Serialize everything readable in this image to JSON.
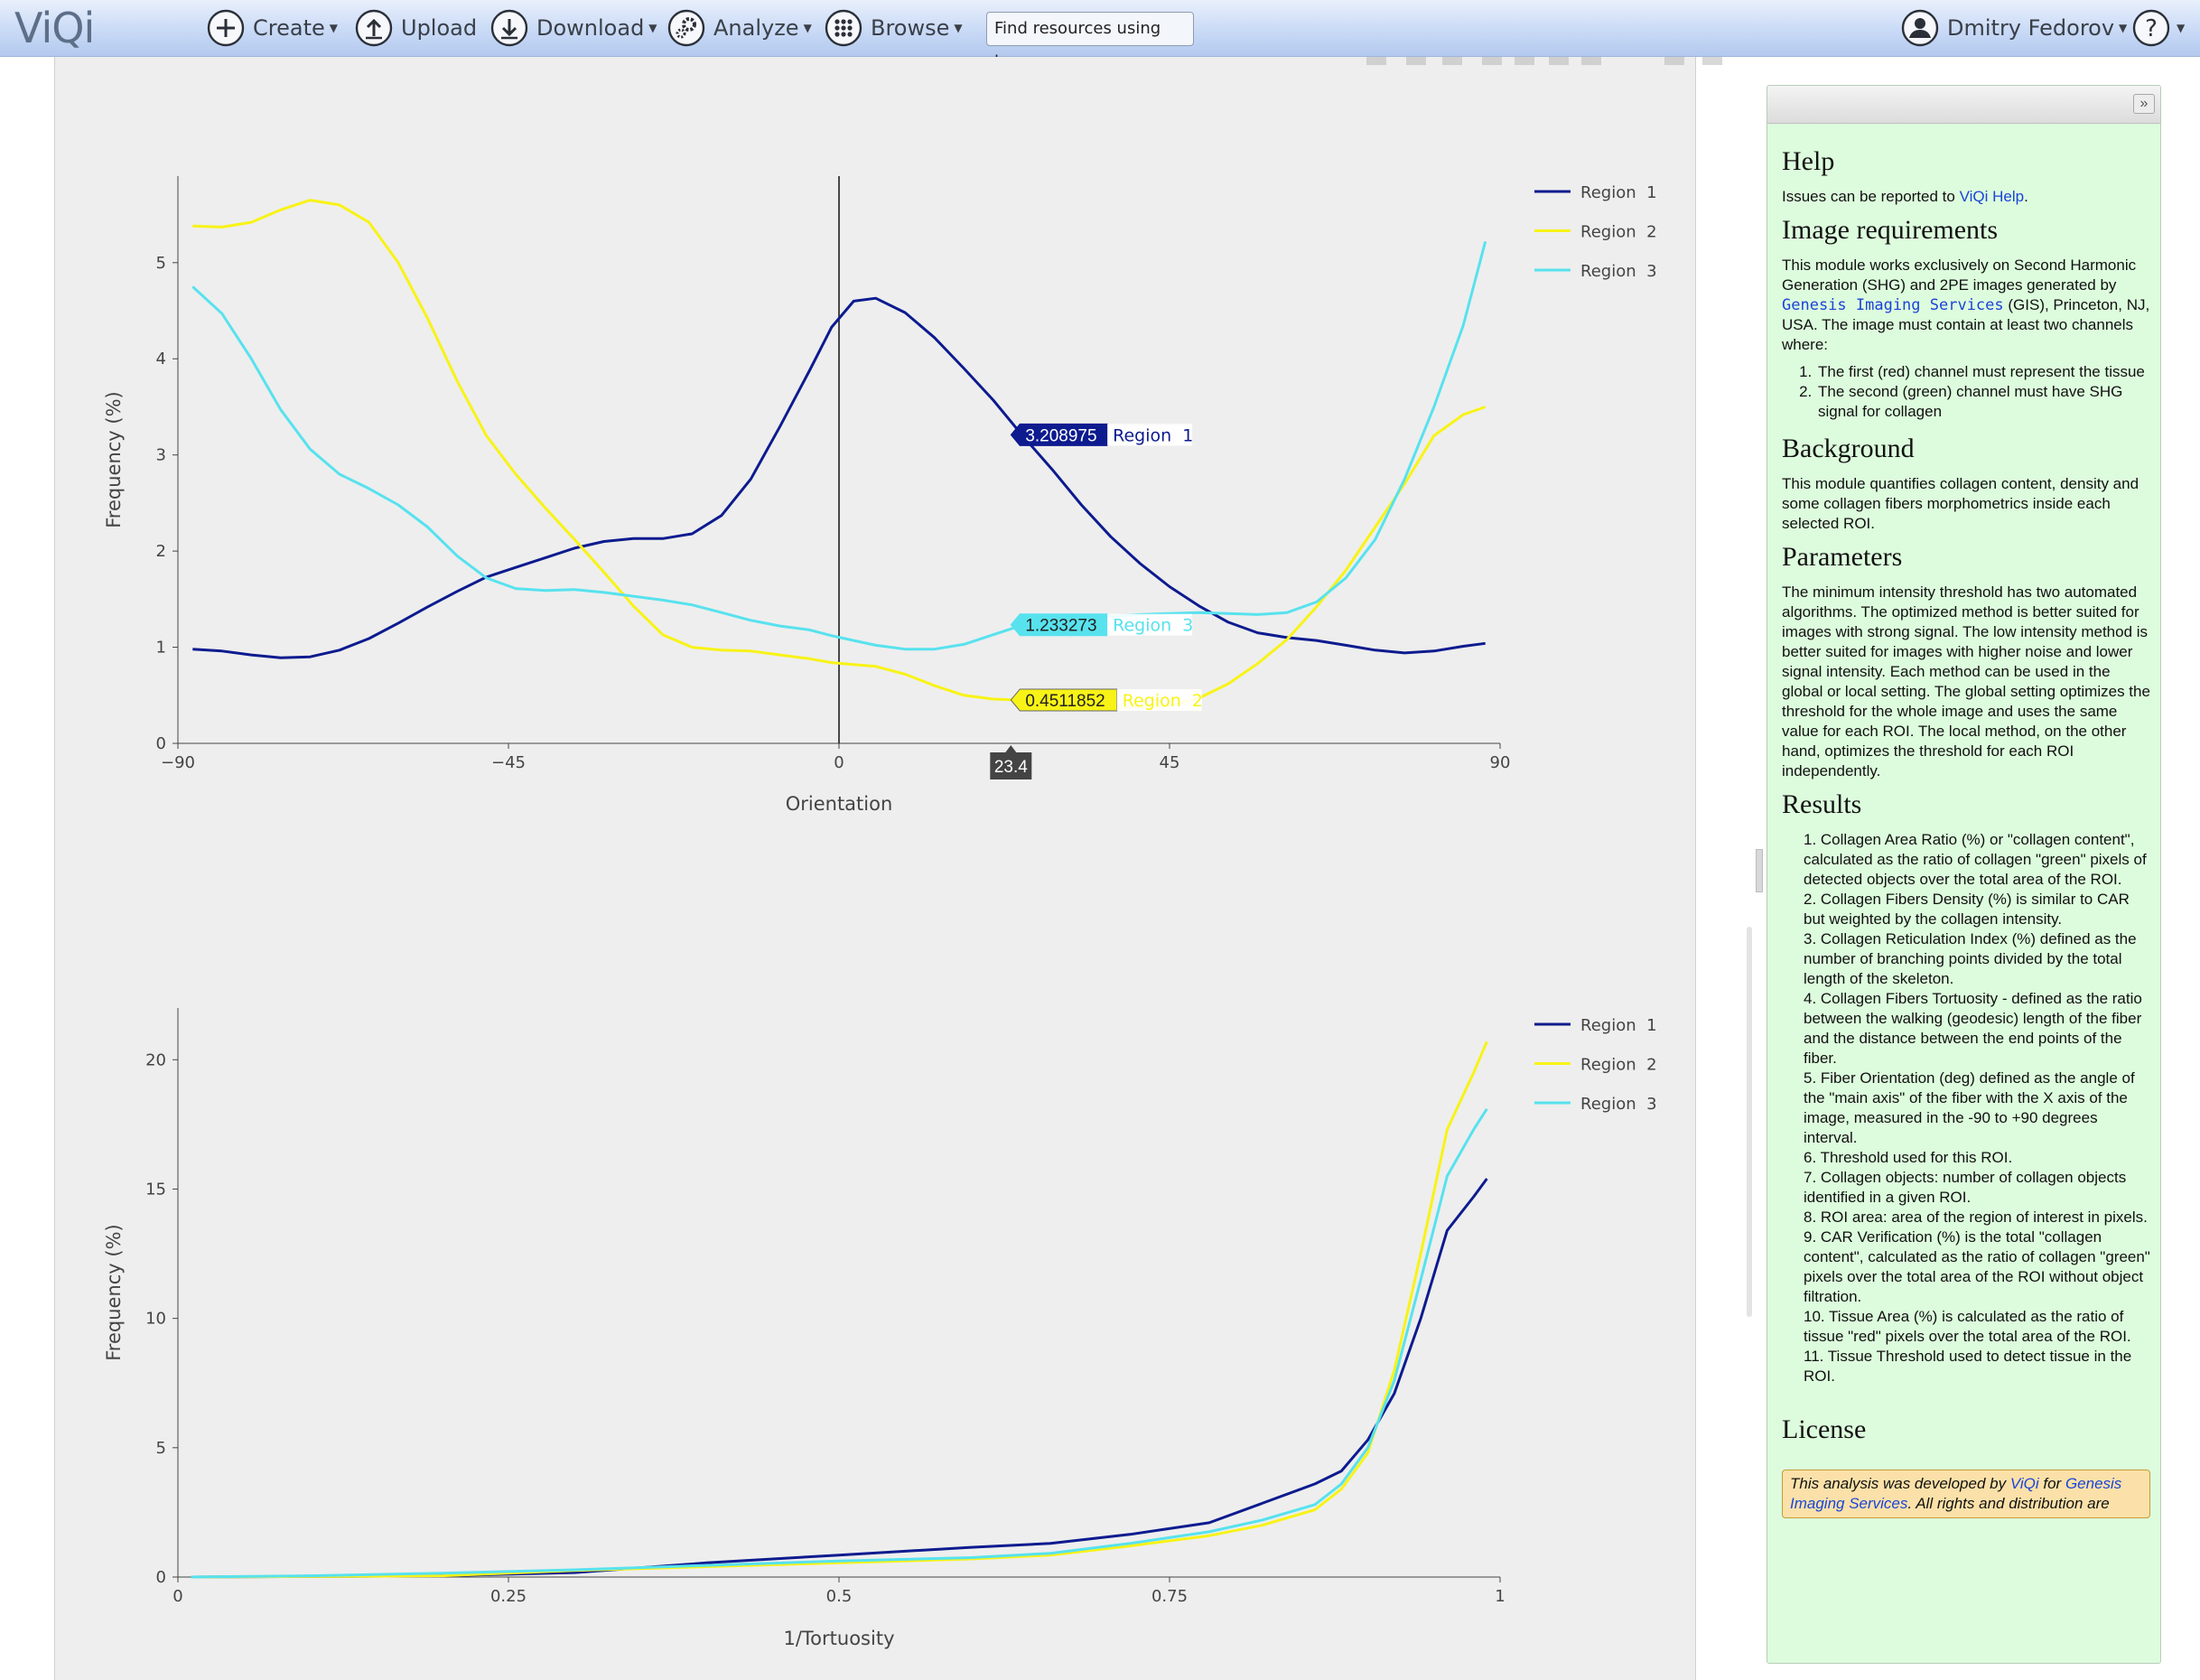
{
  "app": {
    "logo": "ViQi"
  },
  "nav": {
    "create": "Create",
    "upload": "Upload",
    "download": "Download",
    "analyze": "Analyze",
    "browse": "Browse",
    "tag_search": "Find resources using tags",
    "user": "Dmitry Fedorov",
    "help_menu": "?"
  },
  "colors": {
    "region1": "#0d1b8f",
    "region2": "#f8f316",
    "region3": "#57e2ee",
    "panel_bg": "#ddfcdd",
    "plot_bg": "#eeeeee"
  },
  "chart_data": [
    {
      "type": "line",
      "xlabel": "Orientation",
      "ylabel": "Frequency (%)",
      "xlim": [
        -90,
        90
      ],
      "ylim": [
        0,
        5.9
      ],
      "x_ticks": [
        -90,
        -45,
        0,
        45,
        90
      ],
      "x_tick_labels": [
        "−90",
        "−45",
        "0",
        "45",
        "90"
      ],
      "y_ticks": [
        0,
        1,
        2,
        3,
        4,
        5
      ],
      "y_tick_labels": [
        "0",
        "1",
        "2",
        "3",
        "4",
        "5"
      ],
      "grid": false,
      "legend_position": "top-right",
      "x": [
        -88,
        -84,
        -80,
        -76,
        -72,
        -68,
        -64,
        -60,
        -56,
        -52,
        -48,
        -44,
        -40,
        -36,
        -32,
        -28,
        -24,
        -20,
        -16,
        -12,
        -8,
        -4,
        -1,
        2,
        5,
        9,
        13,
        17,
        21,
        25,
        29,
        33,
        37,
        41,
        45,
        49,
        53,
        57,
        61,
        65,
        69,
        73,
        77,
        81,
        85,
        88
      ],
      "series": [
        {
          "name": "Region 1",
          "values": [
            0.98,
            0.96,
            0.92,
            0.89,
            0.9,
            0.97,
            1.09,
            1.25,
            1.42,
            1.58,
            1.73,
            1.83,
            1.93,
            2.03,
            2.1,
            2.13,
            2.13,
            2.18,
            2.37,
            2.75,
            3.3,
            3.88,
            4.33,
            4.6,
            4.63,
            4.48,
            4.22,
            3.9,
            3.57,
            3.2,
            2.85,
            2.48,
            2.15,
            1.87,
            1.63,
            1.43,
            1.26,
            1.15,
            1.1,
            1.07,
            1.02,
            0.97,
            0.94,
            0.96,
            1.01,
            1.04
          ]
        },
        {
          "name": "Region 2",
          "values": [
            5.38,
            5.37,
            5.42,
            5.55,
            5.65,
            5.6,
            5.42,
            5.0,
            4.42,
            3.77,
            3.2,
            2.8,
            2.45,
            2.12,
            1.78,
            1.43,
            1.13,
            1.0,
            0.97,
            0.96,
            0.92,
            0.88,
            0.84,
            0.82,
            0.8,
            0.72,
            0.6,
            0.5,
            0.46,
            0.45,
            0.46,
            0.4,
            0.37,
            0.38,
            0.39,
            0.47,
            0.62,
            0.83,
            1.08,
            1.42,
            1.8,
            2.25,
            2.7,
            3.2,
            3.42,
            3.5
          ]
        },
        {
          "name": "Region 3",
          "values": [
            4.75,
            4.47,
            4.0,
            3.47,
            3.06,
            2.8,
            2.65,
            2.48,
            2.25,
            1.95,
            1.72,
            1.61,
            1.59,
            1.6,
            1.57,
            1.53,
            1.49,
            1.44,
            1.36,
            1.28,
            1.22,
            1.18,
            1.12,
            1.07,
            1.02,
            0.98,
            0.98,
            1.03,
            1.13,
            1.23,
            1.26,
            1.29,
            1.32,
            1.34,
            1.35,
            1.36,
            1.35,
            1.34,
            1.36,
            1.47,
            1.72,
            2.12,
            2.75,
            3.5,
            4.35,
            5.22
          ]
        }
      ],
      "hover": {
        "x_label": "23.4",
        "labels": [
          {
            "value": "3.208975",
            "name": "Region 1",
            "y": 3.208975
          },
          {
            "value": "1.233273",
            "name": "Region 3",
            "y": 1.233273
          },
          {
            "value": "0.4511852",
            "name": "Region 2",
            "y": 0.4511852
          }
        ]
      }
    },
    {
      "type": "line",
      "xlabel": "1/Tortuosity",
      "ylabel": "Frequency (%)",
      "xlim": [
        0,
        1
      ],
      "ylim": [
        0,
        22
      ],
      "x_ticks": [
        0,
        0.25,
        0.5,
        0.75,
        1
      ],
      "x_tick_labels": [
        "0",
        "0.25",
        "0.5",
        "0.75",
        "1"
      ],
      "y_ticks": [
        0,
        5,
        10,
        15,
        20
      ],
      "y_tick_labels": [
        "0",
        "5",
        "10",
        "15",
        "20"
      ],
      "grid": false,
      "legend_position": "top-right",
      "x": [
        0.01,
        0.1,
        0.2,
        0.3,
        0.4,
        0.5,
        0.6,
        0.66,
        0.72,
        0.78,
        0.82,
        0.86,
        0.88,
        0.9,
        0.92,
        0.94,
        0.96,
        0.98,
        0.99
      ],
      "series": [
        {
          "name": "Region 1",
          "values": [
            0.0,
            0.02,
            0.05,
            0.17,
            0.55,
            0.85,
            1.15,
            1.3,
            1.65,
            2.1,
            2.85,
            3.6,
            4.1,
            5.3,
            7.1,
            10.0,
            13.4,
            14.7,
            15.4
          ]
        },
        {
          "name": "Region 2",
          "values": [
            0.0,
            0.02,
            0.05,
            0.25,
            0.4,
            0.55,
            0.7,
            0.85,
            1.2,
            1.6,
            2.0,
            2.6,
            3.4,
            4.8,
            8.0,
            12.5,
            17.3,
            19.5,
            20.7
          ]
        },
        {
          "name": "Region 3",
          "values": [
            0.0,
            0.05,
            0.15,
            0.28,
            0.45,
            0.62,
            0.75,
            0.92,
            1.3,
            1.75,
            2.2,
            2.8,
            3.6,
            5.0,
            7.6,
            11.5,
            15.5,
            17.3,
            18.1
          ]
        }
      ]
    }
  ],
  "help": {
    "collapse": "»",
    "h_help": "Help",
    "help_text": "Issues can be reported to",
    "help_link": "ViQi Help",
    "help_period": ".",
    "h_requirements": "Image requirements",
    "req_text_1": "This module works exclusively on Second Harmonic Generation (SHG) and 2PE images generated by",
    "req_link": "Genesis Imaging Services",
    "req_text_2": "(GIS), Princeton, NJ, USA. The image must contain at least two channels where:",
    "req_items": [
      "The first (red) channel must represent the tissue",
      "The second (green) channel must have SHG signal for collagen"
    ],
    "h_background": "Background",
    "background_text": "This module quantifies collagen content, density and some collagen fibers morphometrics inside each selected ROI.",
    "h_parameters": "Parameters",
    "parameters_text": "The minimum intensity threshold has two automated algorithms. The optimized method is better suited for images with strong signal. The low intensity method is better suited for images with higher noise and lower signal intensity. Each method can be used in the global or local setting. The global setting optimizes the threshold for the whole image and uses the same value for each ROI. The local method, on the other hand, optimizes the threshold for each ROI independently.",
    "h_results": "Results",
    "results_items": [
      "1. Collagen Area Ratio (%) or \"collagen content\", calculated as the ratio of collagen \"green\" pixels of detected objects over the total area of the ROI.",
      "2. Collagen Fibers Density (%) is similar to CAR but weighted by the collagen intensity.",
      "3. Collagen Reticulation Index (%) defined as the number of branching points divided by the total length of the skeleton.",
      "4. Collagen Fibers Tortuosity - defined as the ratio between the walking (geodesic) length of the fiber and the distance between the end points of the fiber.",
      "5. Fiber Orientation (deg) defined as the angle of the \"main axis\" of the fiber with the X axis of the image, measured in the -90 to +90 degrees interval.",
      "6. Threshold used for this ROI.",
      "7. Collagen objects: number of collagen objects identified in a given ROI.",
      "8. ROI area: area of the region of interest in pixels.",
      "9. CAR Verification (%) is the total \"collagen content\", calculated as the ratio of collagen \"green\" pixels over the total area of the ROI without object filtration.",
      "10. Tissue Area (%) is calculated as the ratio of tissue \"red\" pixels over the total area of the ROI.",
      "11. Tissue Threshold used to detect tissue in the ROI."
    ],
    "h_license": "License",
    "license_1": "This analysis was developed by",
    "license_link_1": "ViQi",
    "license_2": "for",
    "license_link_2": "Genesis Imaging Services",
    "license_3": ". All rights and distribution are"
  }
}
